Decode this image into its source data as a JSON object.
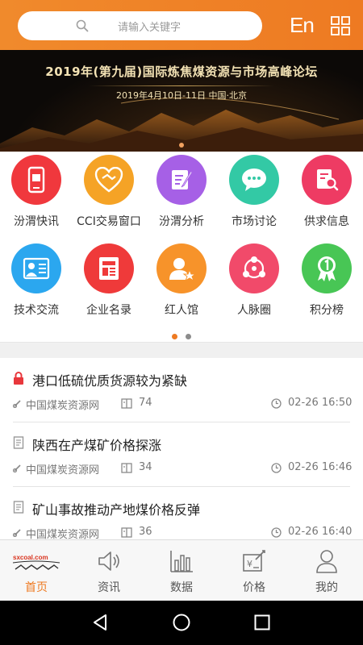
{
  "header": {
    "search_placeholder": "请输入关键字",
    "lang_toggle": "En",
    "menu_icon": "grid-icon"
  },
  "banner": {
    "title": "2019年(第九届)国际炼焦煤资源与市场高峰论坛",
    "subtitle": "2019年4月10日-11日    中国·北京",
    "active_slide": 1,
    "slide_count": 1
  },
  "menu": {
    "items": [
      {
        "label": "汾渭快讯",
        "color": "#f0383d",
        "icon": "phone-news-icon"
      },
      {
        "label": "CCI交易窗口",
        "color": "#f5a326",
        "icon": "handshake-heart-icon"
      },
      {
        "label": "汾渭分析",
        "color": "#a660e6",
        "icon": "edit-document-icon"
      },
      {
        "label": "市场讨论",
        "color": "#33c9a5",
        "icon": "chat-bubble-icon"
      },
      {
        "label": "供求信息",
        "color": "#ee3b63",
        "icon": "search-document-icon"
      },
      {
        "label": "技术交流",
        "color": "#2ba7ef",
        "icon": "id-card-icon"
      },
      {
        "label": "企业名录",
        "color": "#ef3a3a",
        "icon": "directory-icon"
      },
      {
        "label": "红人馆",
        "color": "#f7932a",
        "icon": "user-star-icon"
      },
      {
        "label": "人脉圈",
        "color": "#f14a6a",
        "icon": "network-icon"
      },
      {
        "label": "积分榜",
        "color": "#48c655",
        "icon": "medal-icon"
      }
    ],
    "page_dots": [
      {
        "active": true,
        "color": "#ee7a22"
      },
      {
        "active": false,
        "color": "#8c8c8c"
      }
    ]
  },
  "news": {
    "items": [
      {
        "title": "港口低硫优质货源较为紧缺",
        "source": "中国煤炭资源网",
        "views": "74",
        "time": "02-26 16:50",
        "locked": true
      },
      {
        "title": "陕西在产煤矿价格探涨",
        "source": "中国煤炭资源网",
        "views": "34",
        "time": "02-26 16:46",
        "locked": false
      },
      {
        "title": "矿山事故推动产地煤价格反弹",
        "source": "中国煤炭资源网",
        "views": "36",
        "time": "02-26 16:40",
        "locked": false
      }
    ]
  },
  "tabbar": {
    "items": [
      {
        "label": "首页",
        "icon": "home-logo-icon",
        "active": true
      },
      {
        "label": "资讯",
        "icon": "speaker-icon",
        "active": false
      },
      {
        "label": "数据",
        "icon": "bar-chart-icon",
        "active": false
      },
      {
        "label": "价格",
        "icon": "price-tag-icon",
        "active": false
      },
      {
        "label": "我的",
        "icon": "user-icon",
        "active": false
      }
    ]
  },
  "colors": {
    "brand_orange": "#ee7a22",
    "lock_red": "#e8373c"
  }
}
